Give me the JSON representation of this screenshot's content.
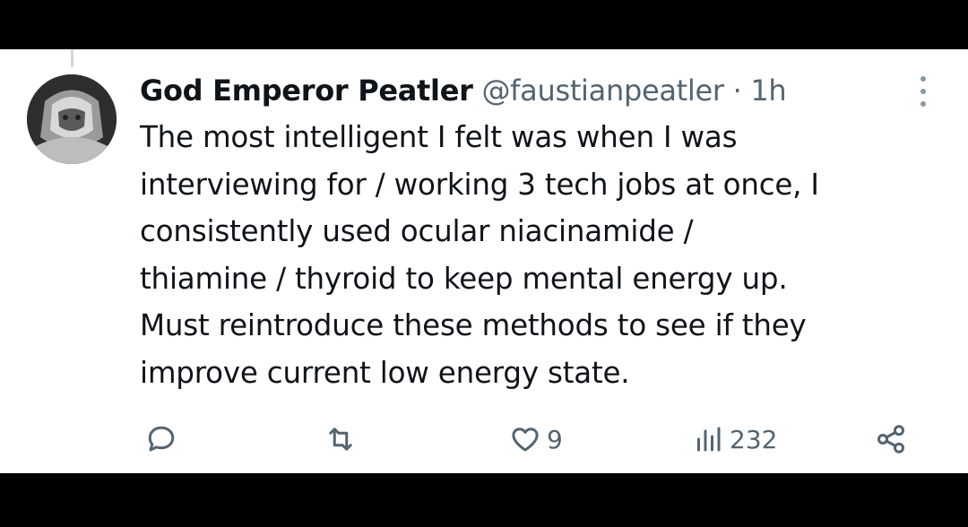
{
  "tweet": {
    "display_name": "God Emperor Peatler",
    "handle": "@faustianpeatler",
    "separator": "·",
    "time": "1h",
    "text_lines": [
      "The most intelligent I felt was when I was",
      "interviewing for / working 3 tech jobs at once, I",
      "consistently used ocular niacinamide /",
      "thiamine / thyroid to keep mental energy up.",
      "Must reintroduce these methods to see if they",
      "improve current low energy state."
    ]
  },
  "actions": {
    "reply": {
      "icon": "reply-icon"
    },
    "retweet": {
      "icon": "retweet-icon"
    },
    "like": {
      "icon": "heart-icon",
      "count": "9"
    },
    "views": {
      "icon": "views-chart-icon",
      "count": "232"
    },
    "share": {
      "icon": "share-icon"
    }
  },
  "colors": {
    "primary_text": "#0f1419",
    "secondary_text": "#536471",
    "background": "#ffffff",
    "frame": "#000000"
  }
}
